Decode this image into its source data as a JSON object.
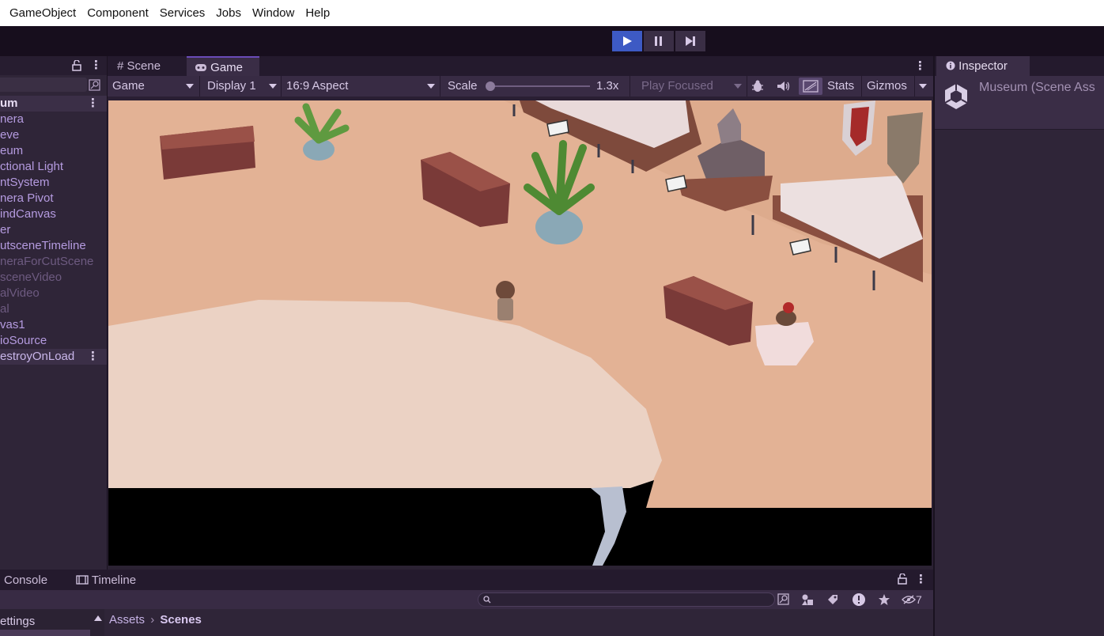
{
  "menu": {
    "items": [
      "GameObject",
      "Component",
      "Services",
      "Jobs",
      "Window",
      "Help"
    ]
  },
  "playbar": {
    "play_icon": "play-icon",
    "pause_icon": "pause-icon",
    "step_icon": "step-icon",
    "accent": "#3d5ac4"
  },
  "hierarchy": {
    "lock_icon": "lock-icon",
    "rows": [
      {
        "label": "um",
        "kind": "scene"
      },
      {
        "label": "nera",
        "kind": "normal"
      },
      {
        "label": "eve",
        "kind": "normal"
      },
      {
        "label": "eum",
        "kind": "normal"
      },
      {
        "label": "ctional Light",
        "kind": "normal"
      },
      {
        "label": "ntSystem",
        "kind": "normal"
      },
      {
        "label": "nera Pivot",
        "kind": "normal"
      },
      {
        "label": "indCanvas",
        "kind": "normal"
      },
      {
        "label": "er",
        "kind": "normal"
      },
      {
        "label": "utsceneTimeline",
        "kind": "normal"
      },
      {
        "label": "neraForCutScene",
        "kind": "dim"
      },
      {
        "label": "sceneVideo",
        "kind": "dim"
      },
      {
        "label": "alVideo",
        "kind": "dim"
      },
      {
        "label": "al",
        "kind": "dim"
      },
      {
        "label": "vas1",
        "kind": "normal"
      },
      {
        "label": "ioSource",
        "kind": "normal"
      },
      {
        "label": "estroyOnLoad",
        "kind": "ddol"
      }
    ]
  },
  "game_view": {
    "tabs": [
      {
        "label": "Scene",
        "icon": "hash-icon"
      },
      {
        "label": "Game",
        "icon": "gamepad-icon"
      }
    ],
    "toolbar": {
      "mode": "Game",
      "display": "Display 1",
      "aspect": "16:9 Aspect",
      "scale_label": "Scale",
      "scale_value": "1.3x",
      "play_mode": "Play Focused",
      "stats": "Stats",
      "gizmos": "Gizmos"
    }
  },
  "inspector": {
    "tab": "Inspector",
    "object_name": "Museum (Scene Ass"
  },
  "bottom": {
    "tabs": [
      {
        "label": "Console",
        "icon": "console-icon"
      },
      {
        "label": "Timeline",
        "icon": "timeline-icon"
      }
    ],
    "left_item": "ettings",
    "breadcrumb_root": "Assets",
    "breadcrumb_current": "Scenes",
    "hidden_count": "7"
  }
}
